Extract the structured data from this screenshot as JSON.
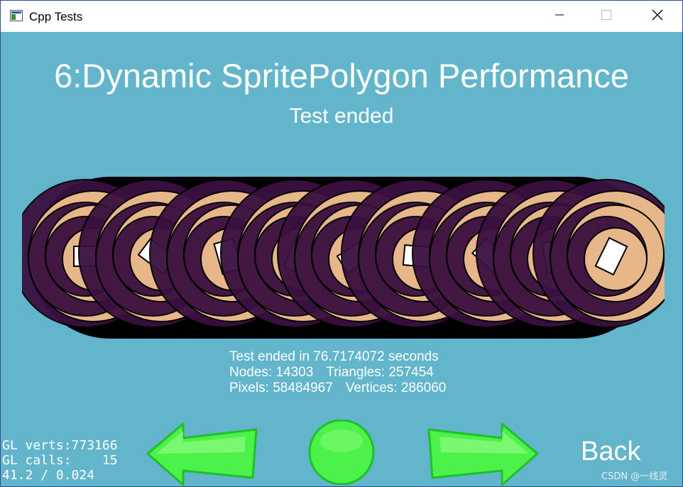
{
  "window": {
    "title": "Cpp Tests",
    "controls": [
      "minimize-icon",
      "maximize-icon",
      "close-icon"
    ]
  },
  "test": {
    "title": "6:Dynamic SpritePolygon Performance",
    "subtitle": "Test ended",
    "result_line": "Test ended in 76.7174072 seconds",
    "nodes": "Nodes: 14303",
    "triangles": "Triangles: 257454",
    "pixels": "Pixels: 58484967",
    "vertices": "Vertices: 286060"
  },
  "navigation": {
    "prev_icon": "left-arrow-icon",
    "restart_icon": "restart-circle-icon",
    "next_icon": "right-arrow-icon",
    "back_label": "Back"
  },
  "gl_stats": {
    "verts": "GL verts:773166",
    "calls": "GL calls:    15",
    "fps": "41.2 / 0.024"
  },
  "watermark": "CSDN @一线灵",
  "colors": {
    "background": "#63b5cb",
    "arrow_green": "#4cf24a",
    "arrow_outline": "#1fbf2a",
    "sprite_skin": "#f0c08e",
    "sprite_dark": "#3a1040"
  }
}
